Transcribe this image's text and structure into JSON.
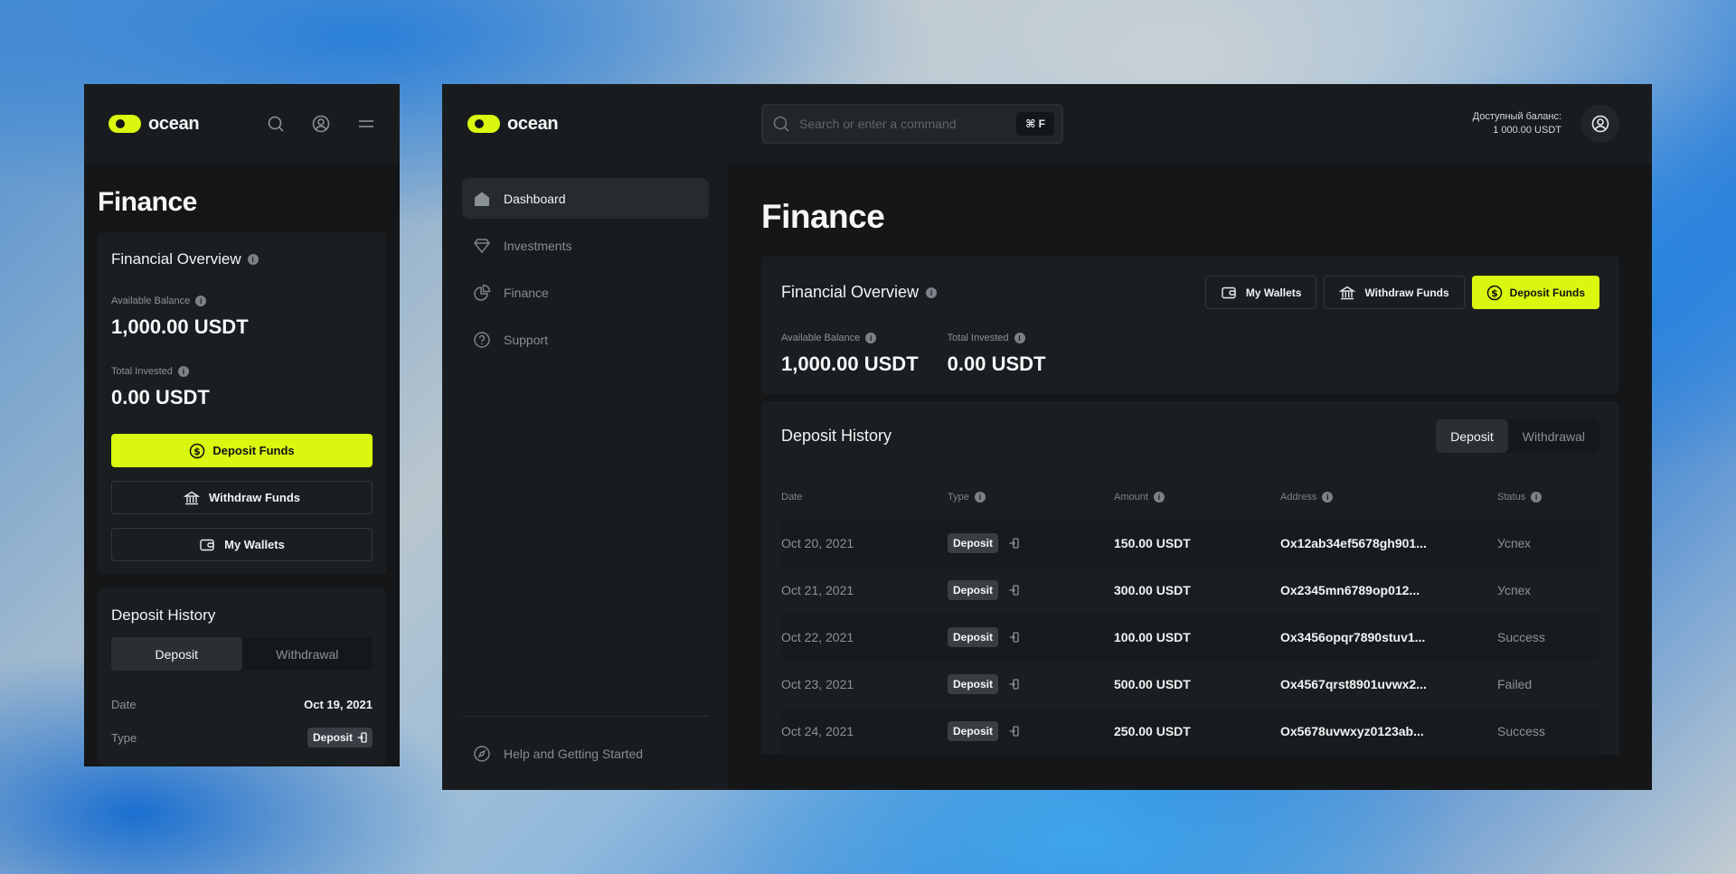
{
  "brand": {
    "name": "ocean"
  },
  "mobile": {
    "title": "Finance",
    "overview": {
      "title": "Financial Overview",
      "available_label": "Available Balance",
      "available_value": "1,000.00 USDT",
      "invested_label": "Total Invested",
      "invested_value": "0.00 USDT",
      "deposit_btn": "Deposit Funds",
      "withdraw_btn": "Withdraw Funds",
      "wallets_btn": "My Wallets"
    },
    "history": {
      "title": "Deposit History",
      "tab_deposit": "Deposit",
      "tab_withdrawal": "Withdrawal",
      "date_label": "Date",
      "date_value": "Oct 19, 2021",
      "type_label": "Type",
      "type_value": "Deposit"
    }
  },
  "desktop": {
    "sidebar": {
      "items": [
        {
          "label": "Dashboard",
          "icon": "home-icon"
        },
        {
          "label": "Investments",
          "icon": "diamond-icon"
        },
        {
          "label": "Finance",
          "icon": "pie-chart-icon"
        },
        {
          "label": "Support",
          "icon": "help-circle-icon"
        }
      ],
      "help": "Help and Getting Started"
    },
    "search": {
      "placeholder": "Search or enter a command",
      "shortcut": "⌘ F"
    },
    "balance": {
      "label": "Доступный баланс:",
      "value": "1 000.00 USDT"
    },
    "title": "Finance",
    "overview": {
      "title": "Financial Overview",
      "wallets_btn": "My Wallets",
      "withdraw_btn": "Withdraw Funds",
      "deposit_btn": "Deposit Funds",
      "available_label": "Available Balance",
      "available_value": "1,000.00 USDT",
      "invested_label": "Total Invested",
      "invested_value": "0.00 USDT"
    },
    "history": {
      "title": "Deposit History",
      "tab_deposit": "Deposit",
      "tab_withdrawal": "Withdrawal",
      "columns": {
        "date": "Date",
        "type": "Type",
        "amount": "Amount",
        "address": "Address",
        "status": "Status"
      },
      "rows": [
        {
          "date": "Oct 20, 2021",
          "type": "Deposit",
          "amount": "150.00 USDT",
          "address": "Ox12ab34ef5678gh901...",
          "status": "Успех"
        },
        {
          "date": "Oct 21, 2021",
          "type": "Deposit",
          "amount": "300.00 USDT",
          "address": "Ox2345mn6789op012...",
          "status": "Успех"
        },
        {
          "date": "Oct 22, 2021",
          "type": "Deposit",
          "amount": "100.00 USDT",
          "address": "Ox3456opqr7890stuv1...",
          "status": "Success"
        },
        {
          "date": "Oct 23, 2021",
          "type": "Deposit",
          "amount": "500.00 USDT",
          "address": "Ox4567qrst8901uvwx2...",
          "status": "Failed"
        },
        {
          "date": "Oct 24, 2021",
          "type": "Deposit",
          "amount": "250.00 USDT",
          "address": "Ox5678uvwxyz0123ab...",
          "status": "Success"
        }
      ]
    }
  },
  "colors": {
    "accent": "#d9f70f",
    "panel": "#141617",
    "card": "#1b1e20"
  }
}
